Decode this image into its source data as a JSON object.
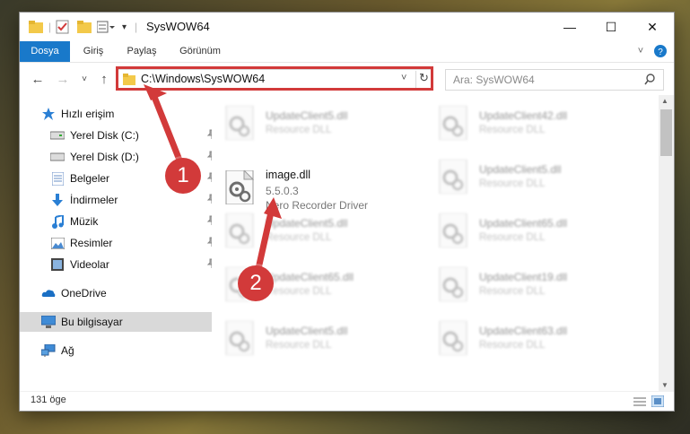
{
  "window": {
    "title": "SysWOW64",
    "minimize_glyph": "—",
    "maximize_glyph": "☐",
    "close_glyph": "✕"
  },
  "ribbon": {
    "tabs": [
      "Dosya",
      "Giriş",
      "Paylaş",
      "Görünüm"
    ],
    "active_tab": "Dosya"
  },
  "address": {
    "path": "C:\\Windows\\SysWOW64",
    "search_placeholder": "Ara: SysWOW64"
  },
  "sidebar": {
    "items": [
      {
        "label": "Hızlı erişim",
        "icon": "star-icon"
      },
      {
        "label": "Yerel Disk (C:)",
        "icon": "drive-icon",
        "pinned": true
      },
      {
        "label": "Yerel Disk (D:)",
        "icon": "drive-icon",
        "pinned": true
      },
      {
        "label": "Belgeler",
        "icon": "documents-icon",
        "pinned": true
      },
      {
        "label": "İndirmeler",
        "icon": "download-icon",
        "pinned": true
      },
      {
        "label": "Müzik",
        "icon": "music-icon",
        "pinned": true
      },
      {
        "label": "Resimler",
        "icon": "pictures-icon",
        "pinned": true
      },
      {
        "label": "Videolar",
        "icon": "videos-icon",
        "pinned": true
      },
      {
        "label": "OneDrive",
        "icon": "cloud-icon"
      },
      {
        "label": "Bu bilgisayar",
        "icon": "computer-icon",
        "selected": true
      },
      {
        "label": "Ağ",
        "icon": "network-icon"
      }
    ]
  },
  "files": {
    "highlighted": {
      "name": "image.dll",
      "version": "5.5.0.3",
      "description": "Nero Recorder Driver"
    },
    "left_column": [
      {
        "name": "UpdateClient5.dll",
        "type": "Resource DLL"
      },
      {
        "name": "UpdateClient5.dll",
        "type": "Resource DLL"
      },
      {
        "name": "UpdateClient65.dll",
        "type": "Resource DLL"
      },
      {
        "name": "UpdateClient5.dll",
        "type": "Resource DLL"
      }
    ],
    "right_column": [
      {
        "name": "UpdateClient42.dll",
        "type": "Resource DLL"
      },
      {
        "name": "UpdateClient5.dll",
        "type": "Resource DLL"
      },
      {
        "name": "UpdateClient65.dll",
        "type": "Resource DLL"
      },
      {
        "name": "UpdateClient19.dll",
        "type": "Resource DLL"
      },
      {
        "name": "UpdateClient63.dll",
        "type": "Resource DLL"
      }
    ]
  },
  "status": {
    "item_count": "131 öge"
  },
  "annotations": {
    "step1": "1",
    "step2": "2",
    "accent_color": "#d23a3a"
  },
  "colors": {
    "ribbon_active": "#1979ca",
    "selection": "#d9d9d9"
  }
}
